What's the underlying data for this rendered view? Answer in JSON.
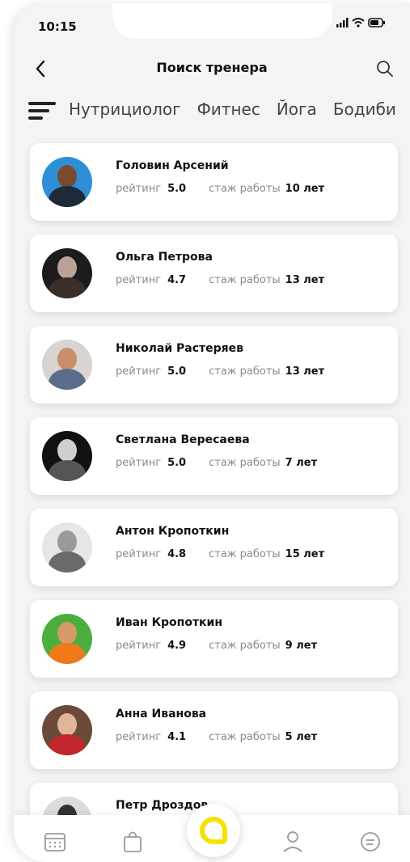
{
  "status_bar": {
    "time": "10:15"
  },
  "header": {
    "title": "Поиск тренера"
  },
  "filters": [
    "Нутрициолог",
    "Фитнес",
    "Йога",
    "Бодиби"
  ],
  "labels": {
    "rating": "рейтинг",
    "experience": "стаж работы"
  },
  "trainers": [
    {
      "name": "Головин Арсений",
      "rating": "5.0",
      "experience": "10 лет"
    },
    {
      "name": "Ольга Петрова",
      "rating": "4.7",
      "experience": "13 лет"
    },
    {
      "name": "Николай Растеряев",
      "rating": "5.0",
      "experience": "13 лет"
    },
    {
      "name": "Светлана Вересаева",
      "rating": "5.0",
      "experience": "7 лет"
    },
    {
      "name": "Антон Кропоткин",
      "rating": "4.8",
      "experience": "15 лет"
    },
    {
      "name": "Иван Кропоткин",
      "rating": "4.9",
      "experience": "9 лет"
    },
    {
      "name": "Анна Иванова",
      "rating": "4.1",
      "experience": "5 лет"
    },
    {
      "name": "Петр Дроздов"
    }
  ],
  "colors": {
    "accent": "#f6e200",
    "background": "#f4f4f4",
    "card": "#ffffff"
  }
}
